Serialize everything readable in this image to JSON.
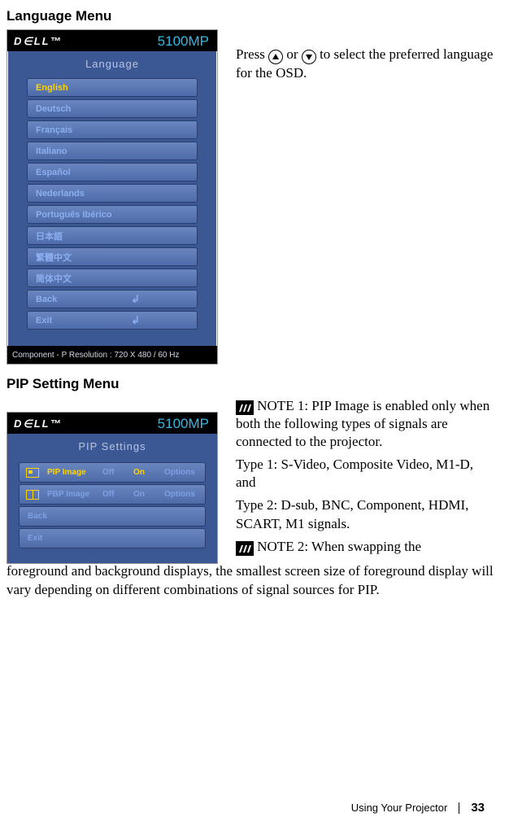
{
  "heading1": "Language Menu",
  "heading2": "PIP Setting Menu",
  "osd1": {
    "brand": "D∈LL™",
    "model": "5100MP",
    "title": "Language",
    "items": [
      "English",
      "Deutsch",
      "Français",
      "Italiano",
      "Español",
      "Nederlands",
      "Português Ibérico",
      "日本語",
      "繁體中文",
      "简体中文",
      "Back",
      "Exit"
    ],
    "footer": "Component - P Resolution : 720 X 480 / 60 Hz"
  },
  "body1a": "Press ",
  "body1b": " or ",
  "body1c": " to select the preferred language for the OSD.",
  "osd2": {
    "brand": "D∈LL™",
    "model": "5100MP",
    "title": "PIP Settings",
    "rowlabels": {
      "pip": "PIP Image",
      "pbp": "PBP Image",
      "off": "Off",
      "on": "On",
      "options": "Options",
      "back": "Back",
      "exit": "Exit"
    }
  },
  "note1": " NOTE 1: PIP Image is enabled only when both the following types of signals are connected to the projector.",
  "type1": "Type 1: S-Video, Composite Video, M1-D, and",
  "type2": "Type 2: D-sub, BNC, Component, HDMI, SCART, M1 signals.",
  "note2a": " NOTE 2: When swapping the ",
  "note2b": "foreground and background displays, the smallest screen size of foreground display will vary depending on different combinations of signal sources for PIP.",
  "footer": {
    "chapter": "Using Your Projector",
    "page": "33"
  }
}
